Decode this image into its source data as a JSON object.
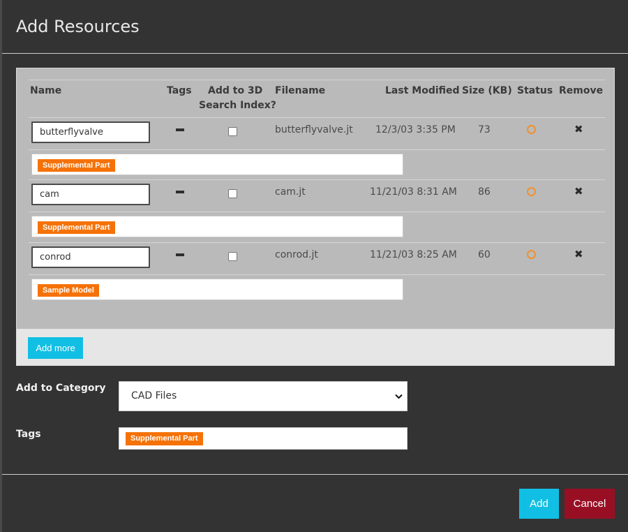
{
  "dialog": {
    "title": "Add Resources"
  },
  "table": {
    "headers": {
      "name": "Name",
      "tags": "Tags",
      "add3d_line1": "Add to 3D",
      "add3d_line2": "Search Index?",
      "filename": "Filename",
      "last_modified": "Last Modified",
      "size": "Size (KB)",
      "status": "Status",
      "remove": "Remove"
    },
    "rows": [
      {
        "name": "butterflyvalve",
        "filename": "butterflyvalve.jt",
        "last_modified": "12/3/03 3:35 PM",
        "size": "73",
        "tag": "Supplemental Part",
        "add_to_3d": false
      },
      {
        "name": "cam",
        "filename": "cam.jt",
        "last_modified": "11/21/03 8:31 AM",
        "size": "86",
        "tag": "Supplemental Part",
        "add_to_3d": false
      },
      {
        "name": "conrod",
        "filename": "conrod.jt",
        "last_modified": "11/21/03 8:25 AM",
        "size": "60",
        "tag": "Sample Model",
        "add_to_3d": false
      }
    ],
    "add_more_label": "Add more"
  },
  "form": {
    "category_label": "Add to Category",
    "category_value": "CAD Files",
    "tags_label": "Tags",
    "tags": [
      "Supplemental Part"
    ]
  },
  "footer": {
    "add_label": "Add",
    "cancel_label": "Cancel"
  },
  "icons": {
    "tags_toggle": "minus-icon",
    "status": "circle-outline-icon",
    "remove": "close-icon",
    "select_arrow": "chevron-down-icon"
  },
  "colors": {
    "accent": "#12bfe4",
    "danger": "#980f24",
    "tag": "#f57209",
    "status": "#f2902d"
  }
}
